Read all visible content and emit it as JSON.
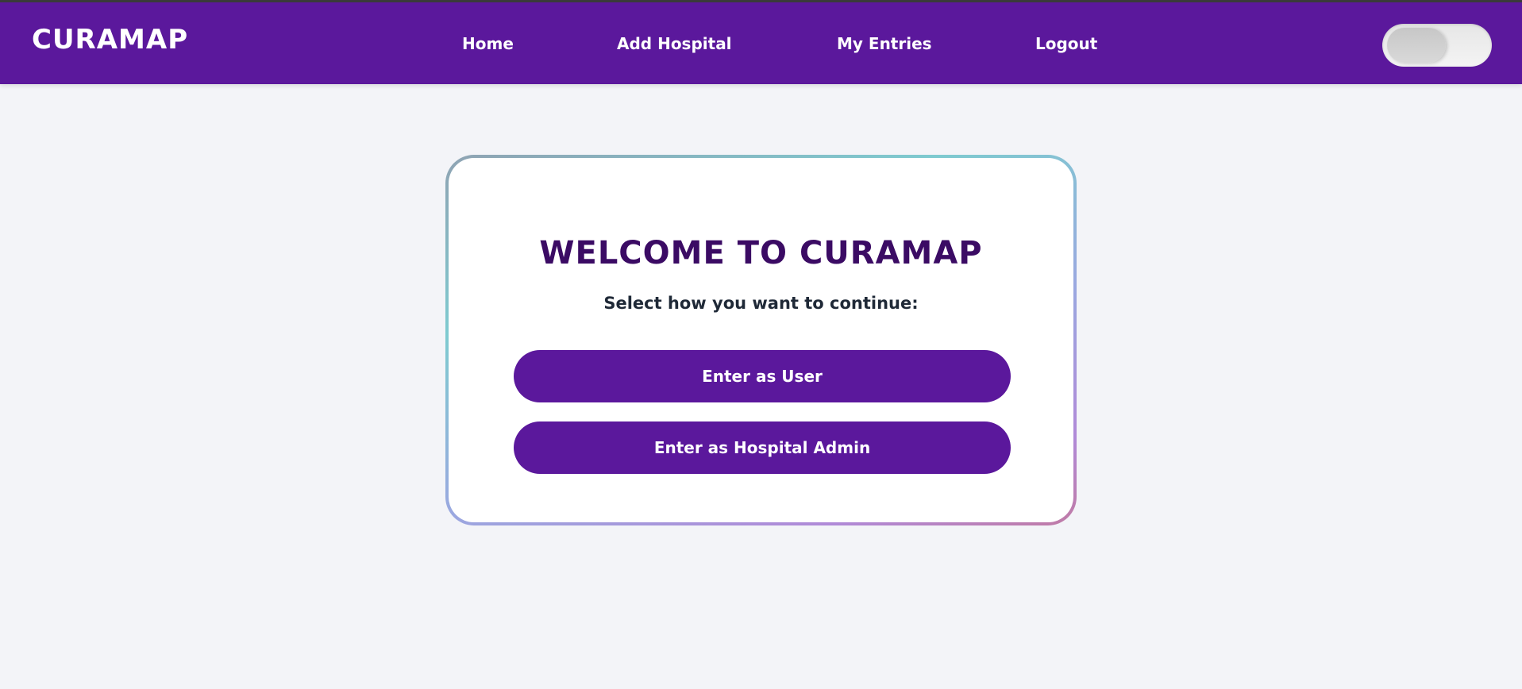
{
  "header": {
    "brand": "CURAMAP",
    "nav": [
      {
        "label": "Home"
      },
      {
        "label": "Add Hospital"
      },
      {
        "label": "My Entries"
      },
      {
        "label": "Logout"
      }
    ],
    "theme_toggle": {
      "state": "off"
    }
  },
  "main": {
    "title": "WELCOME TO CURAMAP",
    "subtitle": "Select how you want to continue:",
    "buttons": [
      {
        "label": "Enter as User"
      },
      {
        "label": "Enter as Hospital Admin"
      }
    ]
  },
  "colors": {
    "brand_purple": "#5b189c",
    "title_purple": "#3b0b64",
    "page_bg": "#f3f4f8"
  }
}
